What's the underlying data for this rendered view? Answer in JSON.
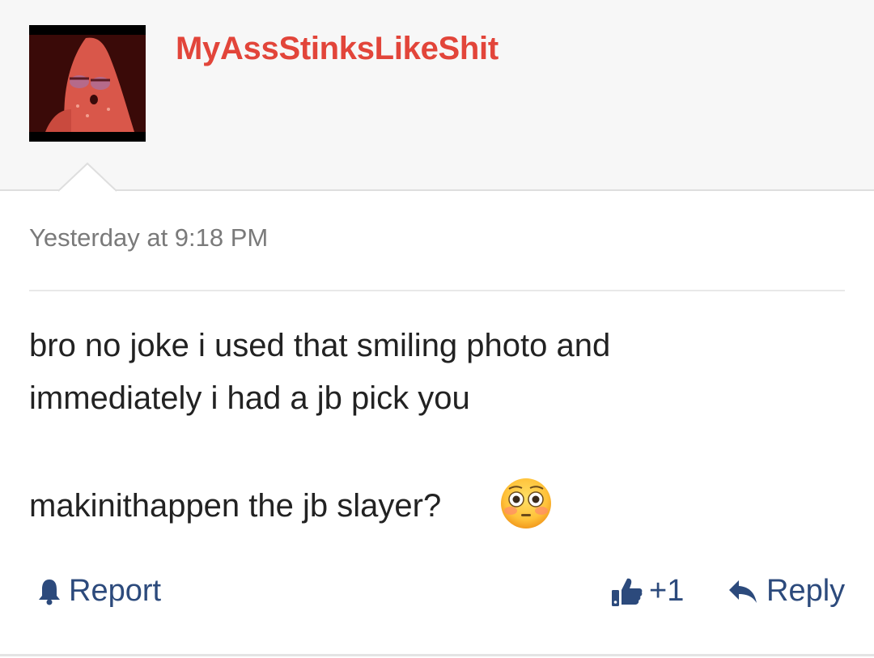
{
  "post": {
    "username": "MyAssStinksLikeShit",
    "timestamp": "Yesterday at 9:18 PM",
    "body_lines": [
      "bro no joke i used that smiling photo and",
      "immediately i had a jb pick you",
      "makinithappen the jb slayer?"
    ],
    "emoji_icon": "flushed-face-icon"
  },
  "actions": {
    "report_label": "Report",
    "like_count": "+1",
    "reply_label": "Reply"
  },
  "colors": {
    "username": "#e2453a",
    "action": "#2c4a7c",
    "text": "#222222",
    "timestamp": "#7a7a7a"
  }
}
